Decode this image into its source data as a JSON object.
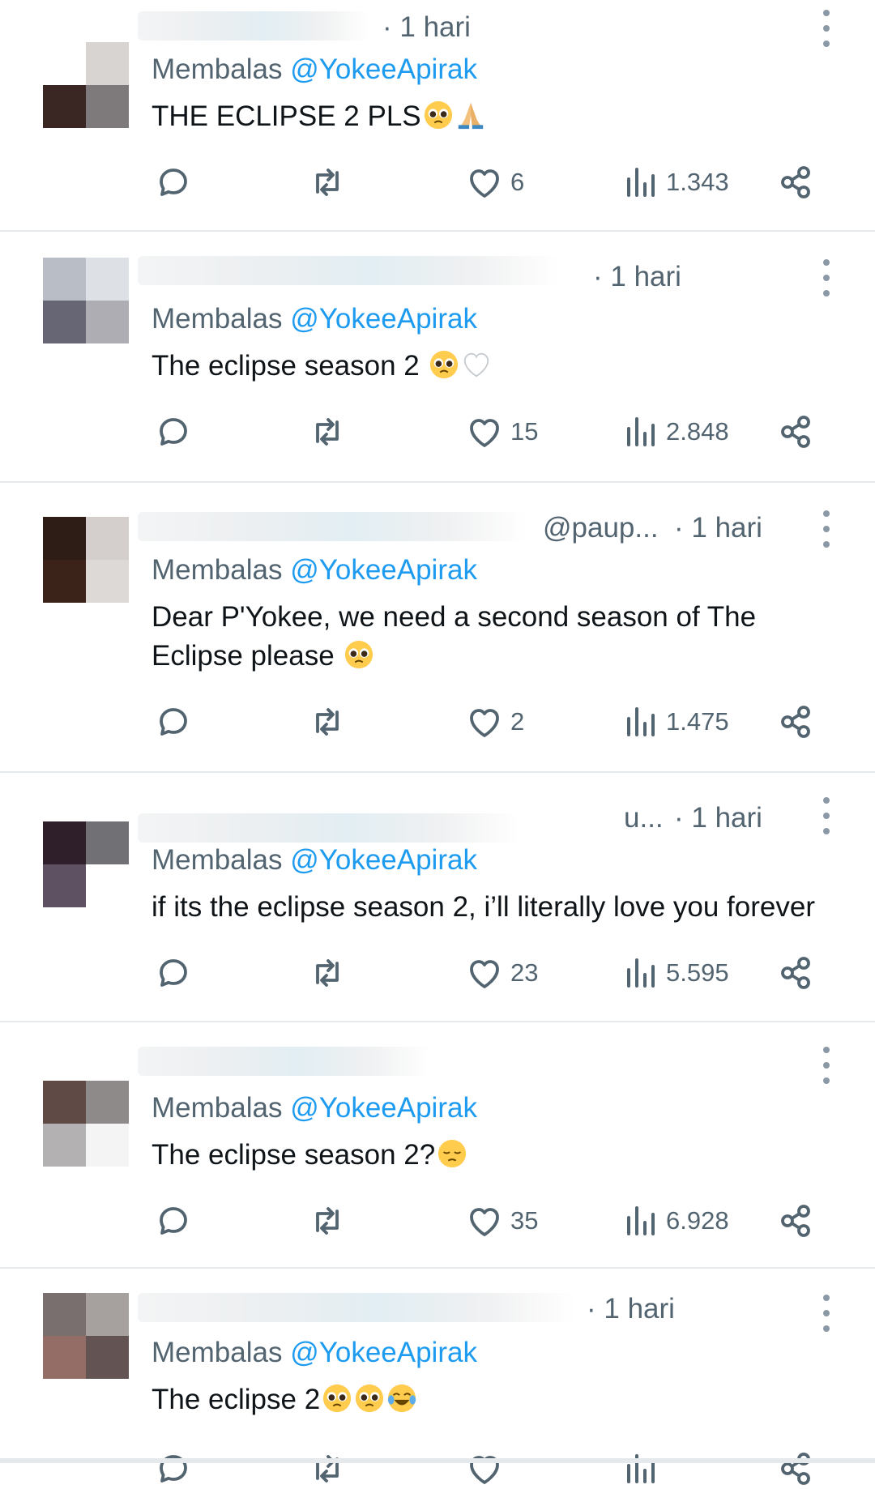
{
  "reply_prefix": "Membalas",
  "reply_to": "@YokeeApirak",
  "colors": {
    "text": "#0f1419",
    "secondary": "#536471",
    "accent": "#1d9bf0",
    "divider": "#e6e9ec"
  },
  "action_icons": [
    "reply-icon",
    "retweet-icon",
    "like-icon",
    "views-icon",
    "share-icon"
  ],
  "tweets": [
    {
      "handle": "",
      "time": "· 1 hari",
      "text": "THE ECLIPSE 2 PLS",
      "emojis": [
        "pleading-face-emoji",
        "folded-hands-emoji"
      ],
      "likes": "6",
      "views": "1.343"
    },
    {
      "handle": "",
      "time": "· 1 hari",
      "text": "The eclipse season 2 ",
      "emojis": [
        "pleading-face-emoji",
        "white-heart-emoji"
      ],
      "likes": "15",
      "views": "2.848"
    },
    {
      "handle": "@paup...",
      "time": "· 1 hari",
      "text": "Dear P'Yokee, we need a second season of The Eclipse please ",
      "emojis": [
        "pleading-face-emoji"
      ],
      "likes": "2",
      "views": "1.475"
    },
    {
      "handle": "u...",
      "time": "· 1 hari",
      "text": "if its the eclipse season 2, i’ll literally love you forever",
      "emojis": [],
      "likes": "23",
      "views": "5.595"
    },
    {
      "handle": "",
      "time": "",
      "text": "The eclipse season 2?",
      "emojis": [
        "pensive-face-emoji"
      ],
      "likes": "35",
      "views": "6.928"
    },
    {
      "handle": "",
      "time": "· 1 hari",
      "text": "The eclipse 2",
      "emojis": [
        "pleading-face-emoji",
        "pleading-face-emoji",
        "tears-of-joy-emoji"
      ],
      "likes": "",
      "views": ""
    }
  ]
}
